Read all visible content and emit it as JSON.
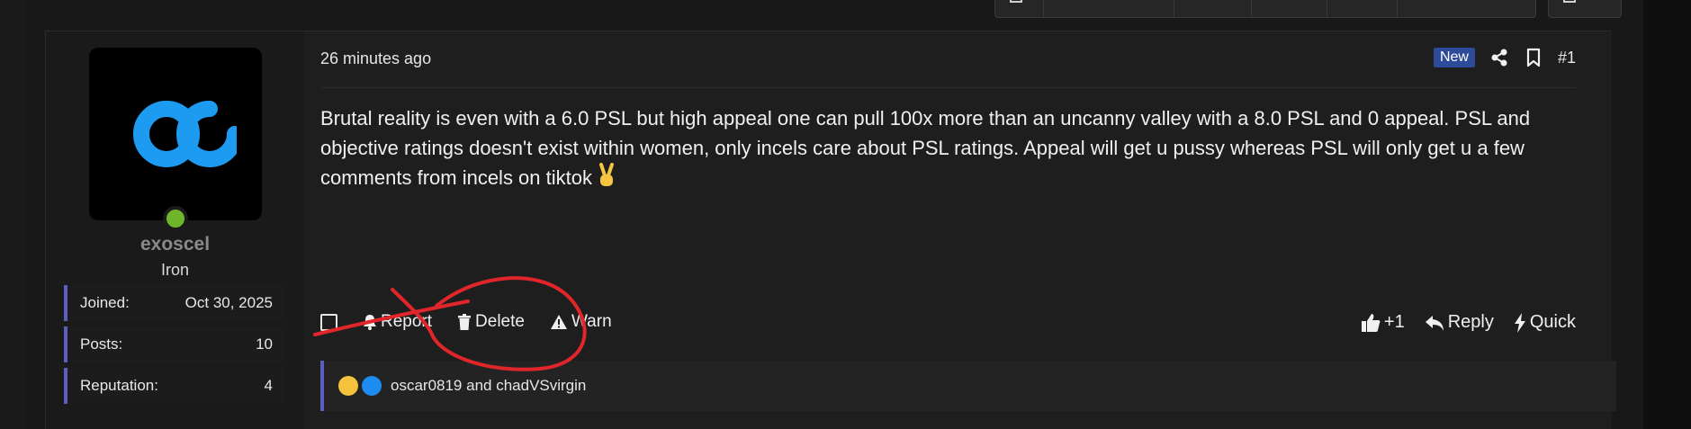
{
  "post": {
    "time": "26 minutes ago",
    "new_badge": "New",
    "number": "#1",
    "message": "Brutal reality is even with a 6.0 PSL but high appeal one can pull 100x more than an uncanny valley with a 8.0 PSL and 0 appeal. PSL and objective ratings doesn't exist within women, only incels care about PSL ratings. Appeal will get u pussy whereas PSL will only get u a few comments from incels on tiktok",
    "message_emoji": "victory-hand",
    "actions": {
      "report": "Report",
      "delete": "Delete",
      "warn": "Warn",
      "like": "+1",
      "reply": "Reply",
      "quick": "Quick"
    },
    "reactions": {
      "users": "oscar0819 and chadVSvirgin",
      "icons": [
        "laughing-crying",
        "thumbs-up"
      ]
    }
  },
  "user": {
    "username": "exoscel",
    "title": "Iron",
    "online": true,
    "stats": [
      {
        "label": "Joined:",
        "value": "Oct 30, 2025"
      },
      {
        "label": "Posts:",
        "value": "10"
      },
      {
        "label": "Reputation:",
        "value": "4"
      }
    ]
  },
  "colors": {
    "accent": "#5a5fc0",
    "avatar_logo": "#1d9bf0",
    "online": "#6fb52c",
    "new_badge": "#2e4a9a",
    "annotation": "#e0262a"
  }
}
